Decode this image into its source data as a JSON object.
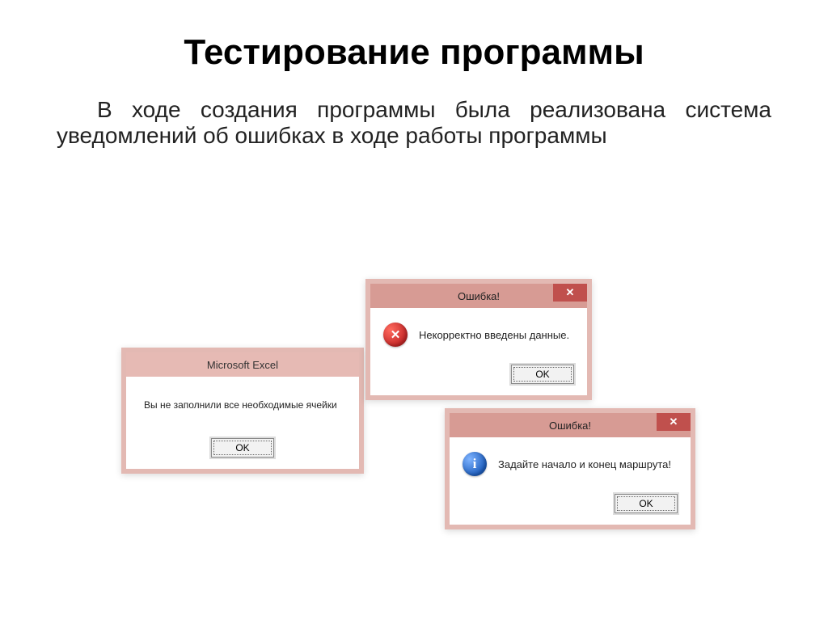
{
  "slide": {
    "title": "Тестирование программы",
    "body": "В ходе создания программы была реализована система уведомлений об ошибках в ходе работы программы"
  },
  "dialogs": {
    "excel": {
      "title": "Microsoft Excel",
      "message": "Вы не заполнили все необходимые ячейки",
      "ok": "OK"
    },
    "error1": {
      "title": "Ошибка!",
      "message": "Некорректно введены данные.",
      "ok": "OK",
      "close": "✕"
    },
    "error2": {
      "title": "Ошибка!",
      "message": "Задайте начало и конец маршрута!",
      "ok": "OK",
      "close": "✕"
    }
  }
}
